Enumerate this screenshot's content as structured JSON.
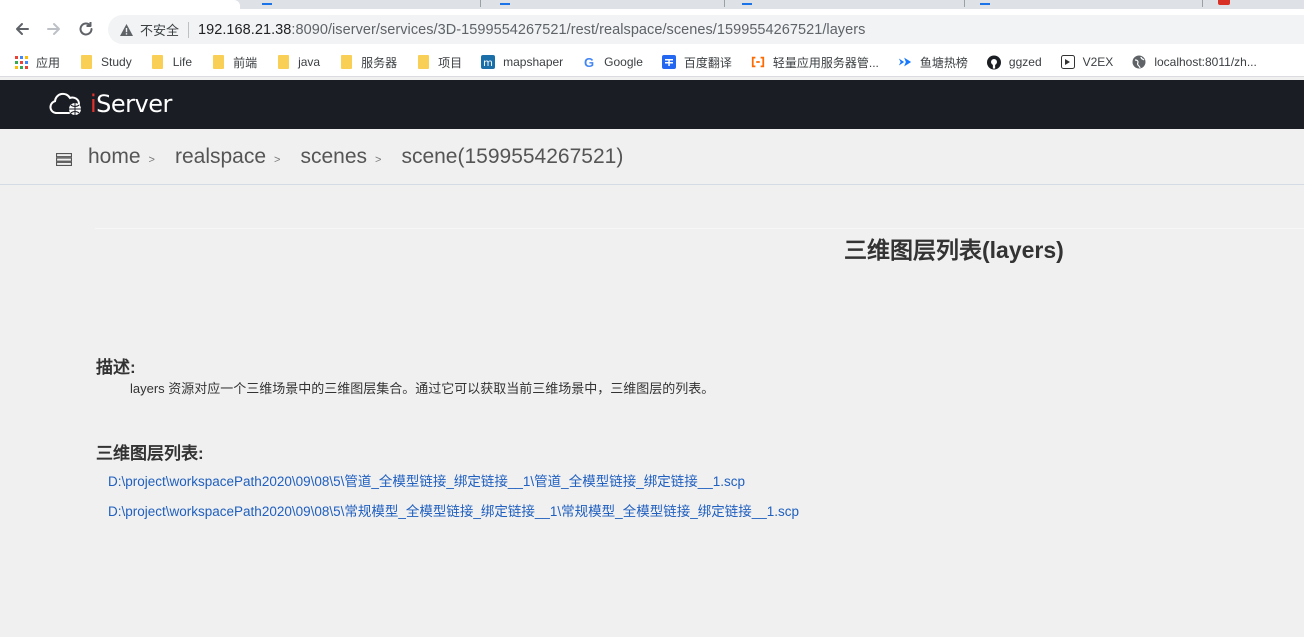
{
  "browser": {
    "insecure_label": "不安全",
    "url_host": "192.168.21.38",
    "url_rest": ":8090/iserver/services/3D-1599554267521/rest/realspace/scenes/1599554267521/layers"
  },
  "bookmarks": [
    {
      "label": "应用",
      "icon": "apps-grid-icon"
    },
    {
      "label": "Study",
      "icon": "folder-icon"
    },
    {
      "label": "Life",
      "icon": "folder-icon"
    },
    {
      "label": "前端",
      "icon": "folder-icon"
    },
    {
      "label": "java",
      "icon": "folder-icon"
    },
    {
      "label": "服务器",
      "icon": "folder-icon"
    },
    {
      "label": "项目",
      "icon": "folder-icon"
    },
    {
      "label": "mapshaper",
      "icon": "mapshaper-icon"
    },
    {
      "label": "Google",
      "icon": "google-icon"
    },
    {
      "label": "百度翻译",
      "icon": "baidu-translate-icon"
    },
    {
      "label": "轻量应用服务器管...",
      "icon": "cloud-bracket-icon"
    },
    {
      "label": "鱼塘热榜",
      "icon": "fish-arrow-icon"
    },
    {
      "label": "ggzed",
      "icon": "github-icon"
    },
    {
      "label": "V2EX",
      "icon": "v2ex-icon"
    },
    {
      "label": "localhost:8011/zh...",
      "icon": "globe-icon"
    }
  ],
  "app": {
    "logo_i": "i",
    "logo_rest": "Server"
  },
  "breadcrumb": {
    "home": "home",
    "realspace": "realspace",
    "scenes": "scenes",
    "current": "scene(1599554267521)",
    "separator": ">"
  },
  "page": {
    "title": "三维图层列表(layers)",
    "desc_label": "描述:",
    "desc_text": "layers 资源对应一个三维场景中的三维图层集合。通过它可以获取当前三维场景中，三维图层的列表。",
    "list_label": "三维图层列表:",
    "layers": [
      "D:\\project\\workspacePath2020\\09\\08\\5\\管道_全模型链接_绑定链接__1\\管道_全模型链接_绑定链接__1.scp",
      "D:\\project\\workspacePath2020\\09\\08\\5\\常规模型_全模型链接_绑定链接__1\\常规模型_全模型链接_绑定链接__1.scp"
    ]
  },
  "colors": {
    "header_bg": "#1a1d24",
    "link": "#1f5fbf",
    "logo_accent": "#e3322d"
  }
}
